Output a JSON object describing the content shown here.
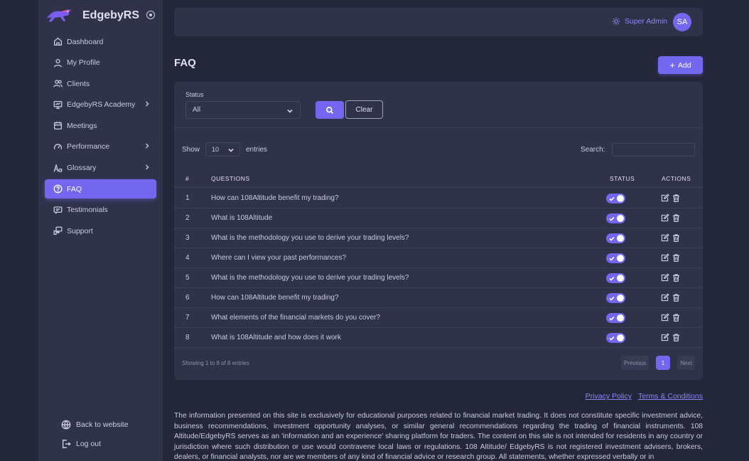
{
  "brand": {
    "name": "EdgebyRS"
  },
  "sidebar": {
    "items": [
      {
        "label": "Dashboard",
        "icon": "home-icon"
      },
      {
        "label": "My Profile",
        "icon": "user-icon"
      },
      {
        "label": "Clients",
        "icon": "users-icon"
      },
      {
        "label": "EdgebyRS Academy",
        "icon": "presentation-icon",
        "has_children": true
      },
      {
        "label": "Meetings",
        "icon": "calendar-icon"
      },
      {
        "label": "Performance",
        "icon": "gauge-icon",
        "has_children": true
      },
      {
        "label": "Glossary",
        "icon": "letters-icon",
        "has_children": true
      },
      {
        "label": "FAQ",
        "icon": "help-circle-icon",
        "active": true
      },
      {
        "label": "Testimonials",
        "icon": "message-icon"
      },
      {
        "label": "Support",
        "icon": "support-icon"
      }
    ],
    "back_to_website": "Back to website",
    "logout": "Log out"
  },
  "header": {
    "user_role": "Super Admin",
    "avatar_initials": "SA"
  },
  "page": {
    "title": "FAQ",
    "add_label": "Add",
    "add_plus": "+"
  },
  "filter": {
    "status_label": "Status",
    "status_value": "All",
    "clear_label": "Clear"
  },
  "table": {
    "show_label": "Show",
    "page_length": "10",
    "entries_label": "entries",
    "search_label": "Search:",
    "columns": {
      "num": "#",
      "questions": "QUESTIONS",
      "status": "STATUS",
      "actions": "ACTIONS"
    },
    "rows": [
      {
        "num": "1",
        "question": "How can 108Altitude benefit my trading?",
        "enabled": true
      },
      {
        "num": "2",
        "question": "What is 108Altitude",
        "enabled": true
      },
      {
        "num": "3",
        "question": "What is the methodology you use to derive your trading levels?",
        "enabled": true
      },
      {
        "num": "4",
        "question": "Where can I view your past performances?",
        "enabled": true
      },
      {
        "num": "5",
        "question": "What is the methodology you use to derive your trading levels?",
        "enabled": true
      },
      {
        "num": "6",
        "question": "How can 108Altitude benefit my trading?",
        "enabled": true
      },
      {
        "num": "7",
        "question": "What elements of the financial markets do you cover?",
        "enabled": true
      },
      {
        "num": "8",
        "question": "What is 108Altitude and how does it work",
        "enabled": true
      }
    ],
    "info": "Showing 1 to 8 of 8 entries",
    "pagination": {
      "previous": "Previous",
      "current": "1",
      "next": "Next"
    }
  },
  "footer": {
    "privacy": "Privacy Policy",
    "terms": "Terms & Conditions",
    "disclaimer": "The information presented on this site is exclusively for educational purposes related to financial market trading. It does not constitute specific investment advice, business recommendations, investment opportunity analyses, or similar general recommendations regarding the trading of financial instruments. 108 Altitude/EdgebyRS serves as an 'information and an experience' sharing platform for traders. The content on this site is not intended for residents in any country or jurisdiction where such distribution or use would contravene local laws or regulations. 108 Altitude/ EdgebyRS is not registered investment advisers, brokers, dealers, or financial analysts, nor are we members of any kind of financial advice or research group. All statements, whether expressed verbally or in"
  },
  "colors": {
    "accent": "#7367f0",
    "background": "#24263a",
    "surface": "#2f3249"
  }
}
